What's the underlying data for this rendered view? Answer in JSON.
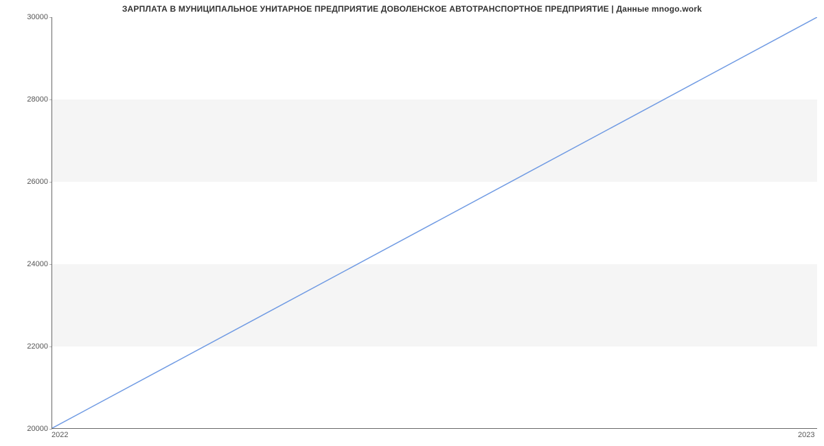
{
  "chart_data": {
    "type": "line",
    "title": "ЗАРПЛАТА В МУНИЦИПАЛЬНОЕ УНИТАРНОЕ ПРЕДПРИЯТИЕ ДОВОЛЕНСКОЕ АВТОТРАНСПОРТНОЕ ПРЕДПРИЯТИЕ | Данные mnogo.work",
    "x": [
      2022,
      2023
    ],
    "values": [
      20000,
      30000
    ],
    "xlabel": "",
    "ylabel": "",
    "xticks": [
      2022,
      2023
    ],
    "yticks": [
      20000,
      22000,
      24000,
      26000,
      28000,
      30000
    ],
    "ylim": [
      20000,
      30000
    ],
    "xlim": [
      2022,
      2023
    ],
    "line_color": "#6f9ae3",
    "bands": true
  }
}
